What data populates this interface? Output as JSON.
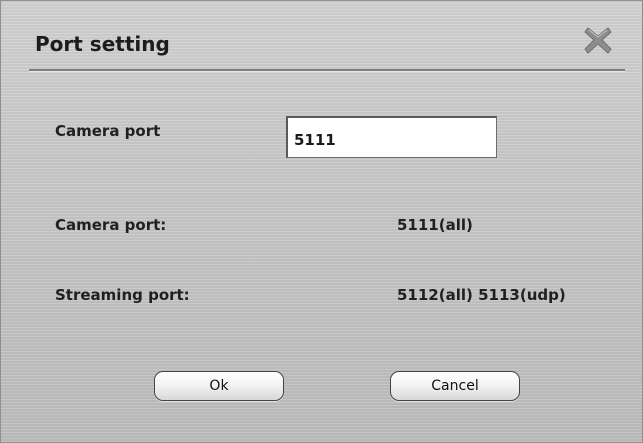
{
  "dialog": {
    "title": "Port setting",
    "close_icon": "close-x-icon"
  },
  "form": {
    "camera_port_label": "Camera port",
    "camera_port_value": "5111"
  },
  "info": {
    "camera_port_label": "Camera port:",
    "camera_port_value": "5111(all)",
    "streaming_port_label": "Streaming port:",
    "streaming_port_value": "5112(all) 5113(udp)"
  },
  "buttons": {
    "ok_label": "Ok",
    "cancel_label": "Cancel"
  }
}
